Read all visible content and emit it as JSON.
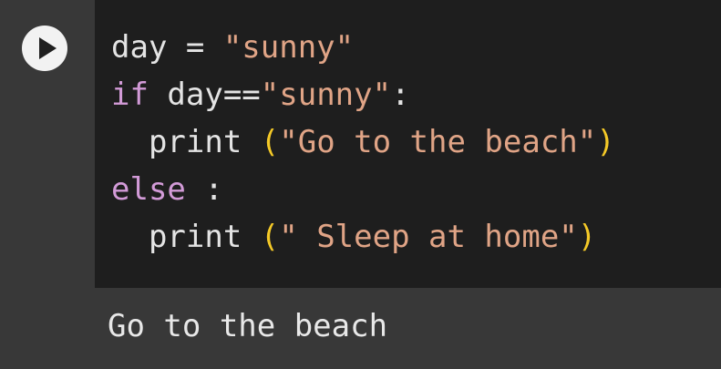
{
  "cell": {
    "run_button_icon": "play-icon",
    "code_lines": [
      [
        {
          "type": "plain",
          "text": "day = "
        },
        {
          "type": "string",
          "text": "\"sunny\""
        }
      ],
      [
        {
          "type": "keyword",
          "text": "if"
        },
        {
          "type": "plain",
          "text": " day=="
        },
        {
          "type": "string",
          "text": "\"sunny\""
        },
        {
          "type": "plain",
          "text": ":"
        }
      ],
      [
        {
          "type": "plain",
          "text": "  print "
        },
        {
          "type": "paren",
          "text": "("
        },
        {
          "type": "string",
          "text": "\"Go to the beach\""
        },
        {
          "type": "paren",
          "text": ")"
        }
      ],
      [
        {
          "type": "keyword",
          "text": "else"
        },
        {
          "type": "plain",
          "text": " :"
        }
      ],
      [
        {
          "type": "plain",
          "text": "  print "
        },
        {
          "type": "paren",
          "text": "("
        },
        {
          "type": "string",
          "text": "\" Sleep at home\""
        },
        {
          "type": "paren",
          "text": ")"
        }
      ]
    ]
  },
  "output": {
    "text": "Go to the beach"
  },
  "colors": {
    "plain": "#e4e4e4",
    "string": "#e0a486",
    "keyword": "#d39bd8",
    "paren": "#f4c927",
    "editor_bg": "#1e1e1e",
    "gutter_bg": "#383838"
  }
}
